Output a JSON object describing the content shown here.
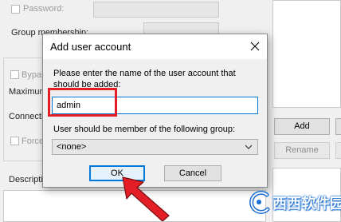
{
  "background": {
    "password_label": "Password:",
    "group_membership_label": "Group membership:",
    "bypass_label": "Bypas",
    "maximum_label": "Maximum",
    "connection_label": "Connectio",
    "force_label": "Force",
    "description_label": "Descriptio",
    "add_button": "Add",
    "rename_button": "Rename"
  },
  "dialog": {
    "title": "Add user account",
    "prompt": "Please enter the name of the user account that should be added:",
    "username_value": "admin",
    "group_label": "User should be member of the following group:",
    "group_selected": "<none>",
    "ok_label": "OK",
    "cancel_label": "Cancel"
  },
  "icons": {
    "close": "close-icon",
    "dropdown": "chevron-down-icon",
    "pointer": "red-arrow-icon",
    "watermark_logo": "watermark-logo-icon"
  },
  "watermark": {
    "text": "西西软件园"
  },
  "colors": {
    "highlight": "#e41e26",
    "accent": "#0078d7",
    "watermark": "#1a6fd1"
  }
}
